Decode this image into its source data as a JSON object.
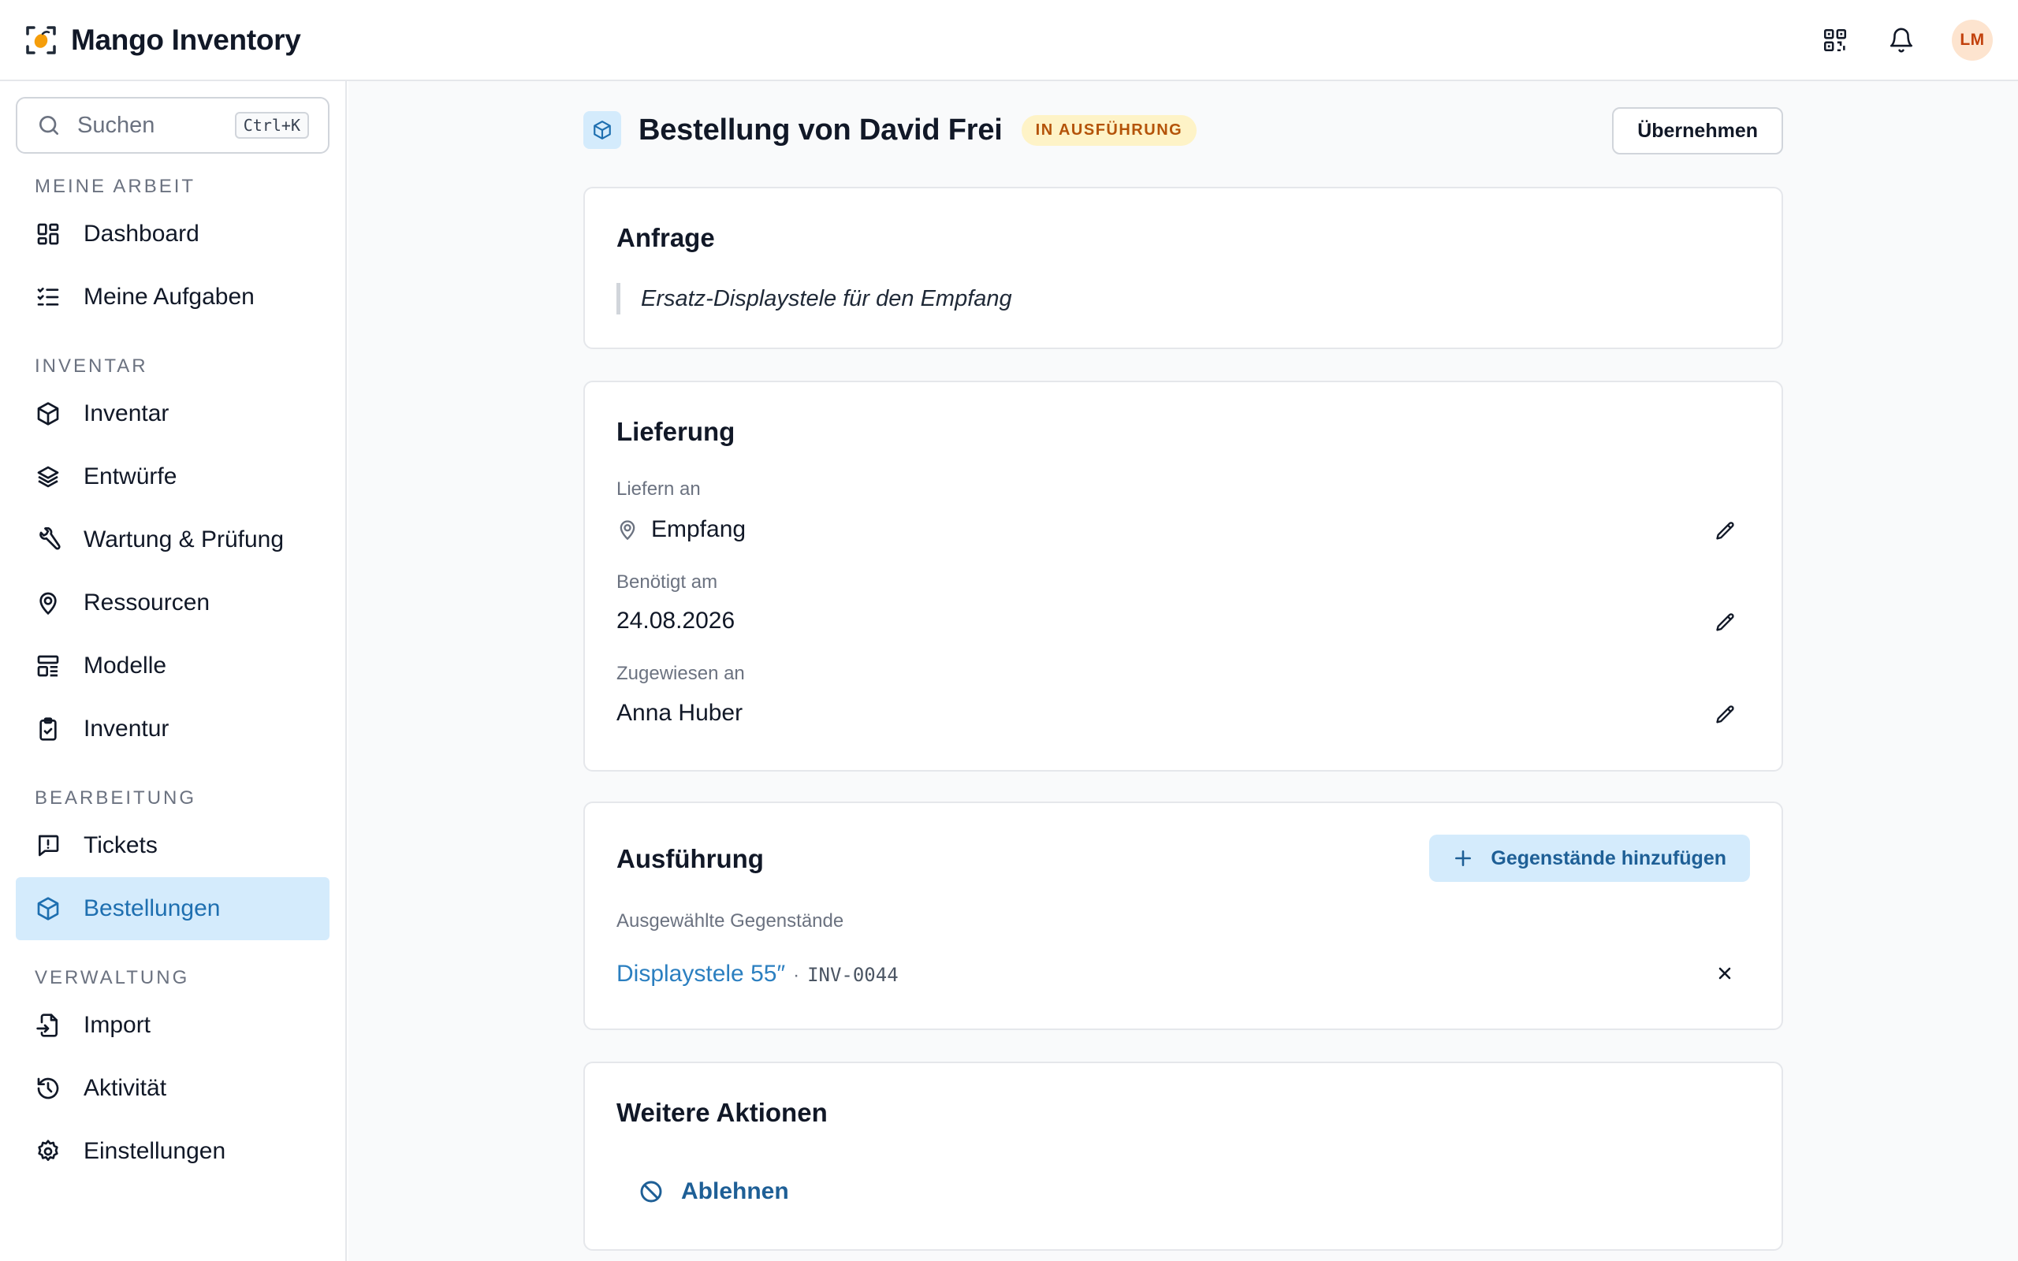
{
  "app": {
    "title": "Mango Inventory",
    "avatar_initials": "LM",
    "colors": {
      "accent": "#2b7fc0",
      "active_bg": "#d4ebfc",
      "logo_orange": "#f59e0b"
    }
  },
  "topbar": {
    "icons": [
      "qr-code-icon",
      "bell-icon"
    ]
  },
  "sidebar": {
    "search": {
      "placeholder": "Suchen",
      "shortcut": "Ctrl+K"
    },
    "sections": [
      {
        "title": "MEINE ARBEIT",
        "items": [
          {
            "label": "Dashboard",
            "icon": "dashboard-icon"
          },
          {
            "label": "Meine Aufgaben",
            "icon": "checklist-icon"
          }
        ]
      },
      {
        "title": "INVENTAR",
        "items": [
          {
            "label": "Inventar",
            "icon": "box-icon"
          },
          {
            "label": "Entwürfe",
            "icon": "layers-icon"
          },
          {
            "label": "Wartung & Prüfung",
            "icon": "wrench-icon"
          },
          {
            "label": "Ressourcen",
            "icon": "map-pin-icon"
          },
          {
            "label": "Modelle",
            "icon": "layout-icon"
          },
          {
            "label": "Inventur",
            "icon": "clipboard-check-icon"
          }
        ]
      },
      {
        "title": "BEARBEITUNG",
        "items": [
          {
            "label": "Tickets",
            "icon": "message-alert-icon"
          },
          {
            "label": "Bestellungen",
            "icon": "box-icon",
            "active": true
          }
        ]
      },
      {
        "title": "VERWALTUNG",
        "items": [
          {
            "label": "Import",
            "icon": "file-import-icon"
          },
          {
            "label": "Aktivität",
            "icon": "history-icon"
          },
          {
            "label": "Einstellungen",
            "icon": "gear-icon"
          }
        ]
      }
    ]
  },
  "page": {
    "title": "Bestellung von David Frei",
    "status": "IN AUSFÜHRUNG",
    "accept_button": "Übernehmen"
  },
  "request": {
    "title": "Anfrage",
    "text": "Ersatz-Displaystele für den Empfang"
  },
  "delivery": {
    "title": "Lieferung",
    "deliver_to_label": "Liefern an",
    "deliver_to_value": "Empfang",
    "needed_label": "Benötigt am",
    "needed_value": "24.08.2026",
    "assigned_label": "Zugewiesen an",
    "assigned_value": "Anna Huber"
  },
  "execution": {
    "title": "Ausführung",
    "add_button": "Gegenstände hinzufügen",
    "selected_label": "Ausgewählte Gegenstände",
    "items": [
      {
        "name": "Displaystele 55″",
        "separator": "·",
        "code": "INV-0044"
      }
    ]
  },
  "more_actions": {
    "title": "Weitere Aktionen",
    "reject": "Ablehnen"
  }
}
